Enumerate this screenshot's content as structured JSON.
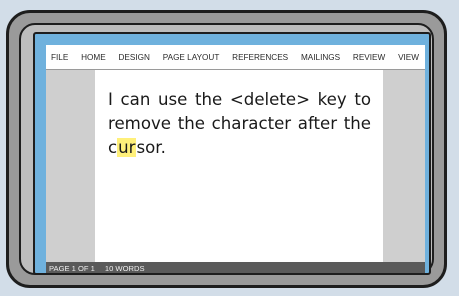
{
  "ribbon": {
    "tabs": [
      "FILE",
      "HOME",
      "DESIGN",
      "PAGE LAYOUT",
      "REFERENCES",
      "MAILINGS",
      "REVIEW",
      "VIEW"
    ]
  },
  "document": {
    "line1": "I can use the <delete> key to",
    "line2": "remove the character after the",
    "line3_before": "c",
    "line3_cursor": "ur",
    "line3_after": "sor."
  },
  "status": {
    "page": "PAGE 1 OF 1",
    "words": "10 WORDS"
  },
  "colors": {
    "screen_border": "#6fb1dd",
    "cursor_highlight": "#fff07a",
    "status_bar": "#5a5a5a"
  }
}
